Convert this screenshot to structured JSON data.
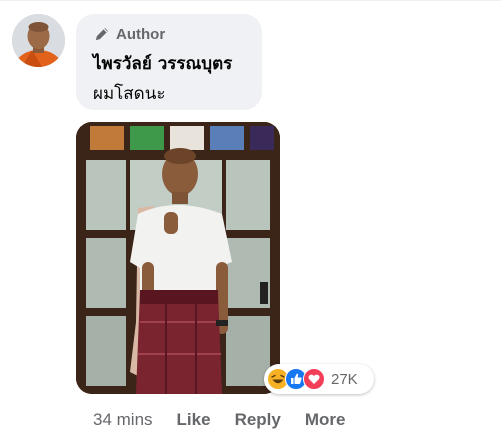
{
  "comment": {
    "author_badge": "Author",
    "author_badge_icon": "pencil-icon",
    "author_name": "ไพรวัลย์ วรรณบุตร",
    "message": "ผมโสดนะ",
    "avatar_icon": "monk-avatar",
    "photo_description_icon": "person-photo"
  },
  "reactions": {
    "icons": [
      "haha-icon",
      "like-icon",
      "love-icon"
    ],
    "count": "27K"
  },
  "actions": {
    "time": "34 mins",
    "like": "Like",
    "reply": "Reply",
    "more": "More"
  },
  "colors": {
    "bubble": "#eff1f4",
    "secondary_text": "#65676b",
    "like_blue": "#1877f2",
    "love_red": "#f33e58",
    "haha_yellow": "#f7b125"
  }
}
